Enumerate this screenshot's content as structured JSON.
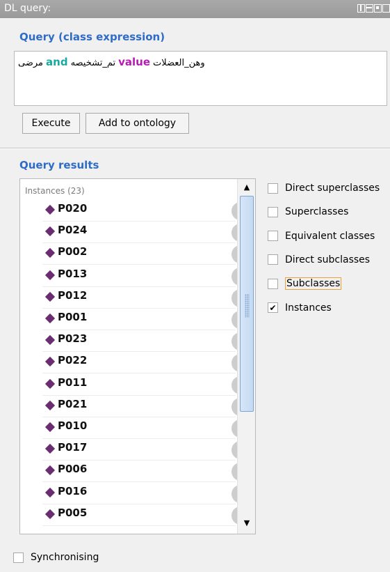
{
  "window": {
    "title": "DL query:"
  },
  "query": {
    "section_title": "Query (class expression)",
    "expr_part1": "مرضى",
    "kw_and": "and",
    "expr_part2": "تم_تشخيصه",
    "kw_value": "value",
    "expr_part3": "وهن_العضلات",
    "execute_label": "Execute",
    "add_label": "Add to ontology"
  },
  "results": {
    "section_title": "Query results",
    "list_header": "Instances (23)",
    "items": [
      "P020",
      "P024",
      "P002",
      "P013",
      "P012",
      "P001",
      "P023",
      "P022",
      "P011",
      "P021",
      "P010",
      "P017",
      "P006",
      "P016",
      "P005"
    ],
    "help_glyph": "?"
  },
  "options": [
    {
      "label": "Direct superclasses",
      "checked": false
    },
    {
      "label": "Superclasses",
      "checked": false
    },
    {
      "label": "Equivalent classes",
      "checked": false
    },
    {
      "label": "Direct subclasses",
      "checked": false
    },
    {
      "label": "Subclasses",
      "checked": false
    },
    {
      "label": "Instances",
      "checked": true
    }
  ],
  "sync": {
    "label": "Synchronising",
    "checked": false
  },
  "colors": {
    "accent": "#2e6cc6",
    "and": "#1aa9a0",
    "value": "#b41db0",
    "instance": "#6a2e70"
  }
}
